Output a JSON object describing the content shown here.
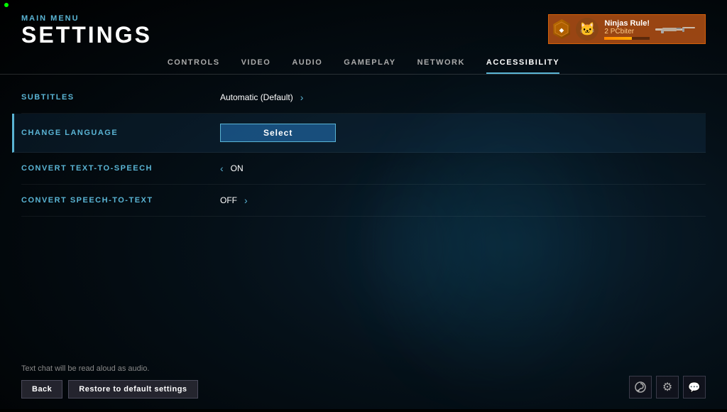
{
  "app": {
    "green_dot": true
  },
  "header": {
    "main_menu_label": "MAIN MENU",
    "settings_title": "SETTINGS"
  },
  "user": {
    "rank_badge": "◆",
    "name": "Ninjas Rule!",
    "rank_text": "2 PCbiter",
    "xp_percent": 60
  },
  "nav": {
    "tabs": [
      {
        "id": "controls",
        "label": "CONTROLS",
        "active": false
      },
      {
        "id": "video",
        "label": "VIDEO",
        "active": false
      },
      {
        "id": "audio",
        "label": "AUDIO",
        "active": false
      },
      {
        "id": "gameplay",
        "label": "GAMEPLAY",
        "active": false
      },
      {
        "id": "network",
        "label": "NETWORK",
        "active": false
      },
      {
        "id": "accessibility",
        "label": "ACCESSIBILITY",
        "active": true
      }
    ]
  },
  "settings": {
    "rows": [
      {
        "id": "subtitles",
        "label": "SUBTITLES",
        "value": "Automatic (Default)",
        "has_right_arrow": true,
        "has_left_arrow": false,
        "type": "value",
        "selected": false
      },
      {
        "id": "change_language",
        "label": "CHANGE LANGUAGE",
        "value": "Select",
        "has_right_arrow": false,
        "has_left_arrow": false,
        "type": "button",
        "selected": true
      },
      {
        "id": "convert_text_to_speech",
        "label": "CONVERT TEXT-TO-SPEECH",
        "value": "ON",
        "has_right_arrow": false,
        "has_left_arrow": true,
        "type": "value",
        "selected": false
      },
      {
        "id": "convert_speech_to_text",
        "label": "CONVERT SPEECH-TO-TEXT",
        "value": "OFF",
        "has_right_arrow": true,
        "has_left_arrow": false,
        "type": "value",
        "selected": false
      }
    ]
  },
  "bottom": {
    "hint_text": "Text chat will be read aloud as audio.",
    "back_button": "Back",
    "restore_button": "Restore to default settings"
  },
  "icons": {
    "steam": "⬡",
    "gear": "⚙",
    "chat": "💬"
  }
}
